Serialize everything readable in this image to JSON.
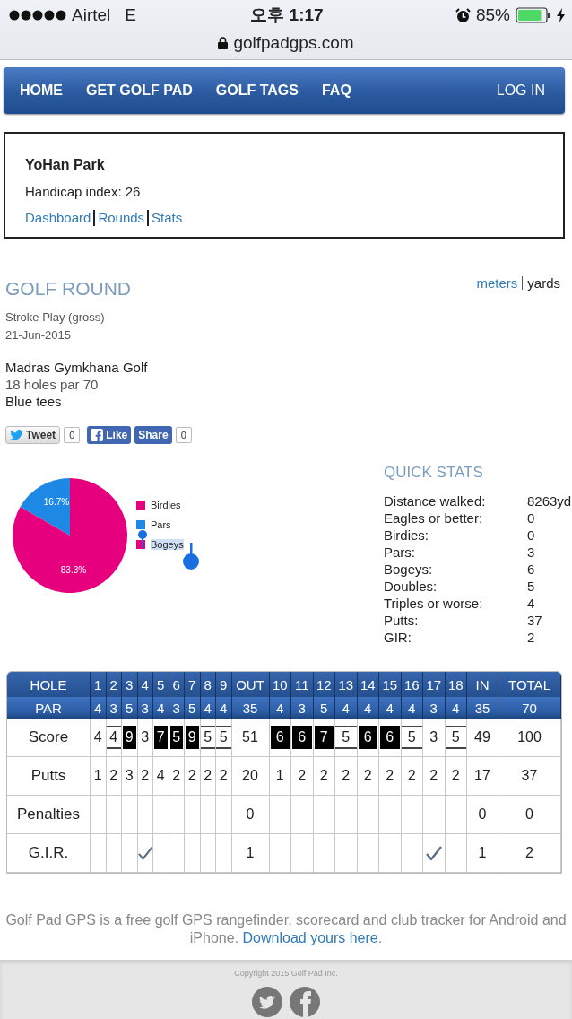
{
  "status_bar": {
    "carrier": "Airtel",
    "network": "E",
    "time": "오후 1:17",
    "battery": "85%",
    "charging": true
  },
  "address_bar": {
    "url": "golfpadgps.com"
  },
  "nav": [
    {
      "label": "HOME",
      "kind": "link"
    },
    {
      "label": "GET GOLF PAD",
      "kind": "link"
    },
    {
      "label": "GOLF TAGS",
      "kind": "link"
    },
    {
      "label": "FAQ",
      "kind": "link"
    },
    {
      "label": "LOG IN",
      "kind": "login"
    }
  ],
  "profile": {
    "name": "YoHan Park",
    "handicap": "Handicap index: 26",
    "links": [
      "Dashboard",
      "Rounds",
      "Stats"
    ]
  },
  "round": {
    "title": "GOLF ROUND",
    "units": [
      {
        "label": "meters",
        "selected": false
      },
      {
        "label": "yards",
        "selected": true
      }
    ],
    "format": "Stroke Play (gross)",
    "date": "21-Jun-2015",
    "course": "Madras Gymkhana Golf",
    "holes_par": "18 holes par 70",
    "tees": "Blue tees"
  },
  "social": [
    {
      "label": "Tweet",
      "kind": "twitter",
      "count": "0"
    },
    {
      "label": "Like",
      "kind": "facebook"
    },
    {
      "label": "Share",
      "kind": "share",
      "count": "0"
    }
  ],
  "chart_data": {
    "type": "pie",
    "categories": [
      "Birdies",
      "Pars",
      "Bogeys"
    ],
    "values": [
      0,
      16.7,
      83.3
    ],
    "colors": [
      "#e6007e",
      "#1e88e5",
      "#e6007e"
    ],
    "value_labels": [
      null,
      "16.7%",
      "83.3%"
    ]
  },
  "legend_items": [
    {
      "selected": false
    },
    {
      "selected": false
    },
    {
      "selected": true
    }
  ],
  "quick_stats": {
    "title": "QUICK STATS",
    "rows": [
      {
        "label": "Distance walked:",
        "value": "8263yd"
      },
      {
        "label": "Eagles or better:",
        "value": "0"
      },
      {
        "label": "Birdies:",
        "value": "0"
      },
      {
        "label": "Pars:",
        "value": "3"
      },
      {
        "label": "Bogeys:",
        "value": "6"
      },
      {
        "label": "Doubles:",
        "value": "5"
      },
      {
        "label": "Triples or worse:",
        "value": "4"
      },
      {
        "label": "Putts:",
        "value": "37"
      },
      {
        "label": "GIR:",
        "value": "2"
      }
    ]
  },
  "scorecard": {
    "row_labels": [
      "HOLE",
      "PAR",
      "Score",
      "Putts",
      "Penalties",
      "G.I.R."
    ],
    "holes": [
      {
        "number": "1",
        "par": "4",
        "score": "4",
        "kind": "par",
        "putts": "1",
        "gir": false
      },
      {
        "number": "2",
        "par": "3",
        "score": "4",
        "kind": "bogey",
        "putts": "2",
        "gir": false
      },
      {
        "number": "3",
        "par": "5",
        "score": "9",
        "kind": "double",
        "putts": "3",
        "gir": false
      },
      {
        "number": "4",
        "par": "3",
        "score": "3",
        "kind": "par",
        "putts": "2",
        "gir": true
      },
      {
        "number": "5",
        "par": "4",
        "score": "7",
        "kind": "double",
        "putts": "4",
        "gir": false
      },
      {
        "number": "6",
        "par": "3",
        "score": "5",
        "kind": "double",
        "putts": "2",
        "gir": false
      },
      {
        "number": "7",
        "par": "5",
        "score": "9",
        "kind": "double",
        "putts": "2",
        "gir": false
      },
      {
        "number": "8",
        "par": "4",
        "score": "5",
        "kind": "bogey",
        "putts": "2",
        "gir": false
      },
      {
        "number": "9",
        "par": "4",
        "score": "5",
        "kind": "bogey",
        "putts": "2",
        "gir": false
      },
      {
        "number": "10",
        "par": "4",
        "score": "6",
        "kind": "double",
        "putts": "1",
        "gir": false
      },
      {
        "number": "11",
        "par": "3",
        "score": "6",
        "kind": "double",
        "putts": "2",
        "gir": false
      },
      {
        "number": "12",
        "par": "5",
        "score": "7",
        "kind": "double",
        "putts": "2",
        "gir": false
      },
      {
        "number": "13",
        "par": "4",
        "score": "5",
        "kind": "bogey",
        "putts": "2",
        "gir": false
      },
      {
        "number": "14",
        "par": "4",
        "score": "6",
        "kind": "double",
        "putts": "2",
        "gir": false
      },
      {
        "number": "15",
        "par": "4",
        "score": "6",
        "kind": "double",
        "putts": "2",
        "gir": false
      },
      {
        "number": "16",
        "par": "4",
        "score": "5",
        "kind": "bogey",
        "putts": "2",
        "gir": false
      },
      {
        "number": "17",
        "par": "3",
        "score": "3",
        "kind": "par",
        "putts": "2",
        "gir": true
      },
      {
        "number": "18",
        "par": "4",
        "score": "5",
        "kind": "bogey",
        "putts": "2",
        "gir": false
      }
    ],
    "out": {
      "label": "OUT",
      "par": "35",
      "score": "51",
      "putts": "20",
      "penalties": "0",
      "gir": "1"
    },
    "in": {
      "label": "IN",
      "par": "35",
      "score": "49",
      "putts": "17",
      "penalties": "0",
      "gir": "1"
    },
    "total": {
      "label": "TOTAL",
      "par": "70",
      "score": "100",
      "putts": "37",
      "penalties": "0",
      "gir": "2"
    }
  },
  "footer": {
    "text": "Golf Pad GPS is a free golf GPS rangefinder, scorecard and club tracker for Android and iPhone.",
    "link": "Download yours here",
    "after": ".",
    "copyright": "Copyright 2015 Golf Pad Inc."
  }
}
